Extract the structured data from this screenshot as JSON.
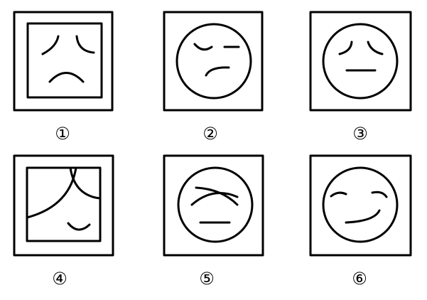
{
  "panels": [
    {
      "label": "①",
      "face": "frown"
    },
    {
      "label": "②",
      "face": "confused"
    },
    {
      "label": "③",
      "face": "neutral"
    },
    {
      "label": "④",
      "face": "partial"
    },
    {
      "label": "⑤",
      "face": "crossed"
    },
    {
      "label": "⑥",
      "face": "smirk"
    }
  ]
}
